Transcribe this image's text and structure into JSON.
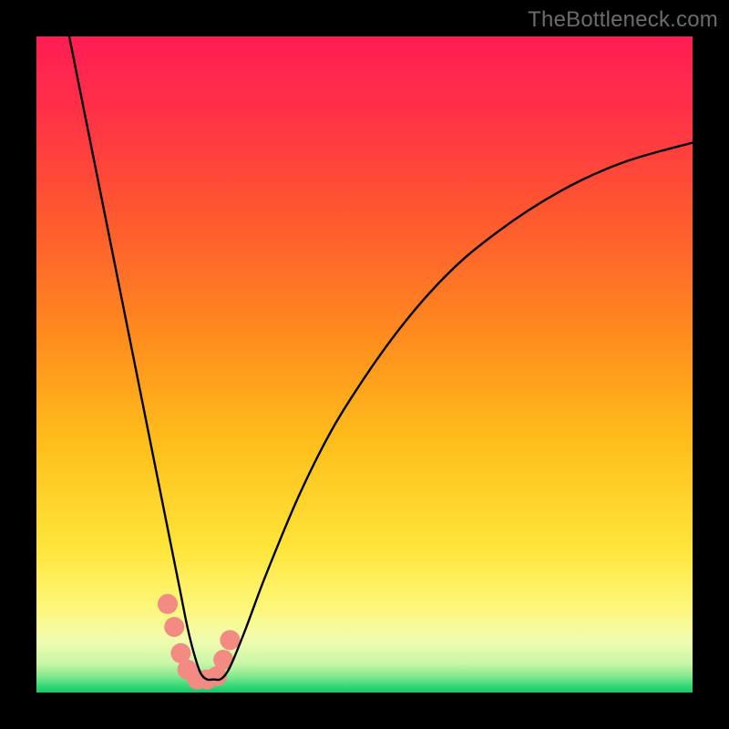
{
  "watermark": "TheBottleneck.com",
  "chart_data": {
    "type": "line",
    "title": "",
    "xlabel": "",
    "ylabel": "",
    "xlim": [
      0,
      100
    ],
    "ylim": [
      0,
      100
    ],
    "grid": false,
    "legend": false,
    "background_gradient_stops": [
      {
        "offset": 0.0,
        "color": "#ff1d55"
      },
      {
        "offset": 0.12,
        "color": "#ff3246"
      },
      {
        "offset": 0.28,
        "color": "#ff5a2f"
      },
      {
        "offset": 0.45,
        "color": "#ff8a1f"
      },
      {
        "offset": 0.62,
        "color": "#ffbf1a"
      },
      {
        "offset": 0.78,
        "color": "#ffe53a"
      },
      {
        "offset": 0.87,
        "color": "#fdf87a"
      },
      {
        "offset": 0.92,
        "color": "#f2fcb0"
      },
      {
        "offset": 0.955,
        "color": "#c9f7a8"
      },
      {
        "offset": 0.975,
        "color": "#86e98f"
      },
      {
        "offset": 0.99,
        "color": "#33d97a"
      },
      {
        "offset": 1.0,
        "color": "#18c862"
      }
    ],
    "series": [
      {
        "name": "bottleneck-curve",
        "color": "#000000",
        "stroke_width": 2.4,
        "x": [
          5,
          7,
          9,
          11,
          13,
          15,
          17,
          19,
          20,
          21,
          22,
          23,
          24,
          25,
          26,
          27,
          28,
          29,
          30,
          32,
          35,
          40,
          45,
          50,
          55,
          60,
          65,
          70,
          75,
          80,
          85,
          90,
          95,
          100
        ],
        "values": [
          100,
          90,
          80,
          70,
          60,
          50,
          40,
          30,
          25,
          20,
          15,
          10,
          6,
          3,
          2,
          2,
          2,
          3,
          5,
          10,
          18,
          30,
          40,
          48,
          55,
          61,
          66,
          70,
          73.5,
          76.5,
          79,
          81,
          82.5,
          83.8
        ]
      }
    ],
    "markers": {
      "name": "highlight-dots",
      "color": "#f28b82",
      "radius": 11,
      "x": [
        20,
        21,
        22,
        23,
        24.5,
        26,
        27.5,
        28.5,
        29.5
      ],
      "values": [
        13.5,
        10,
        6,
        3.5,
        2,
        2,
        2.5,
        5,
        8
      ]
    }
  }
}
